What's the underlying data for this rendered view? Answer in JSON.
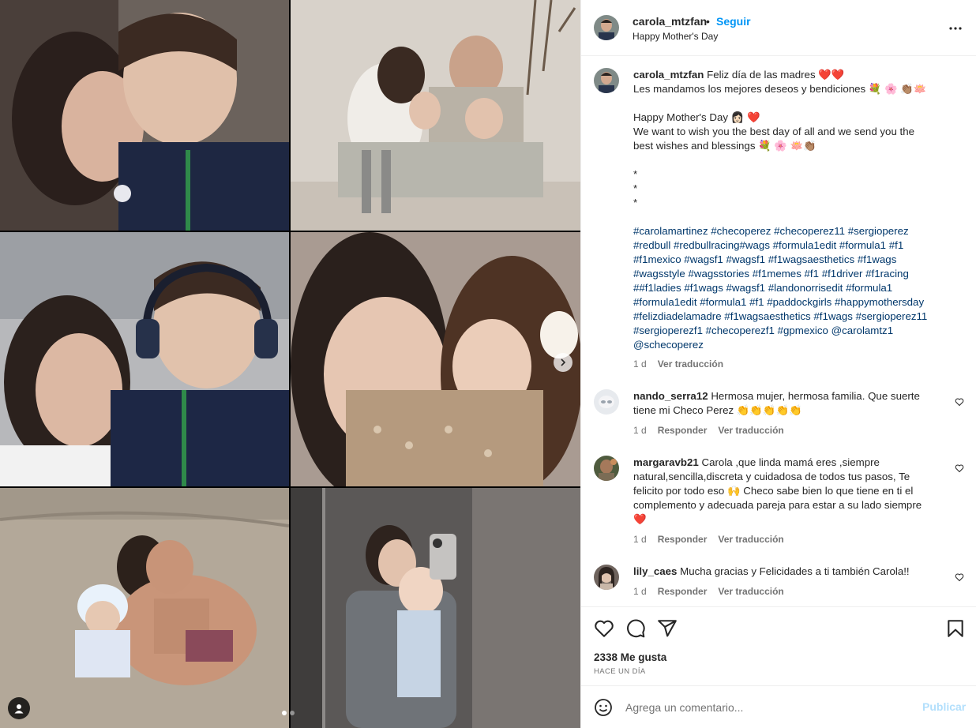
{
  "post": {
    "username": "carola_mtzfan",
    "bullet": "•",
    "follow_label": "Seguir",
    "location": "Happy Mother's Day"
  },
  "photos": [
    {
      "desc": "woman kissing boy in team shirt"
    },
    {
      "desc": "family sitting on floor"
    },
    {
      "desc": "woman and boy with headphones"
    },
    {
      "desc": "girl kissing smiling woman"
    },
    {
      "desc": "woman and children on beach"
    },
    {
      "desc": "mirror selfie with baby"
    }
  ],
  "caption": {
    "username": "carola_mtzfan",
    "lines": [
      "Feliz día de las madres ❤️❤️",
      "Les mandamos los mejores deseos y bendiciones 💐 🌸 👏🏽🪷",
      "",
      "Happy Mother's Day 👩🏻 ❤️",
      "We want to wish you the best day of all and we send you the",
      "best wishes and blessings 💐 🌸 🪷👏🏽",
      "",
      "*",
      "*",
      "*",
      ""
    ],
    "hashtag_lines": [
      "#carolamartinez #checoperez #checoperez11 #sergioperez",
      "#redbull #redbullracing#wags #formula1edit #formula1 #f1",
      "#f1mexico #wagsf1 #wagsf1 #f1wagsaesthetics #f1wags",
      "#wagsstyle #wagsstories #f1memes #f1 #f1driver #f1racing",
      "##f1ladies #f1wags #wagsf1 #landonorrisedit #formula1",
      "#formula1edit #formula1 #f1 #paddockgirls #happymothersday",
      "#felizdiadelamadre #f1wagsaesthetics #f1wags #sergioperez11",
      "#sergioperezf1 #checoperezf1 #gpmexico @carolamtz1",
      "@schecoperez"
    ],
    "time": "1 d",
    "translate": "Ver traducción"
  },
  "comments": [
    {
      "username": "nando_serra12",
      "lines": [
        "Hermosa mujer, hermosa familia. Que suerte",
        "tiene mi Checo Perez 👏👏👏👏👏"
      ],
      "time": "1 d",
      "reply": "Responder",
      "translate": "Ver traducción"
    },
    {
      "username": "margaravb21",
      "lines": [
        "Carola ,que linda mamá eres ,siempre",
        "natural,sencilla,discreta y cuidadosa de todos tus pasos, Te",
        "felicito por todo eso 🙌 Checo sabe bien lo que tiene en ti el",
        "complemento y adecuada pareja para estar a su lado siempre",
        "❤️"
      ],
      "time": "1 d",
      "reply": "Responder",
      "translate": "Ver traducción"
    },
    {
      "username": "lily_caes",
      "lines": [
        "Mucha gracias y Felicidades a ti también Carola!!"
      ],
      "time": "1 d",
      "reply": "Responder",
      "translate": "Ver traducción"
    }
  ],
  "stats": {
    "likes": "2338 Me gusta",
    "when": "HACE UN DÍA"
  },
  "composer": {
    "placeholder": "Agrega un comentario...",
    "post_label": "Publicar"
  },
  "colors": {
    "accent": "#0095f6",
    "hashtag": "#00376b",
    "muted": "#737373",
    "post_disabled": "#b2dffc"
  },
  "icons": [
    "more-icon",
    "heart-icon",
    "comment-icon",
    "share-icon",
    "bookmark-icon",
    "emoji-icon",
    "tag-icon",
    "chevron-right-icon"
  ]
}
